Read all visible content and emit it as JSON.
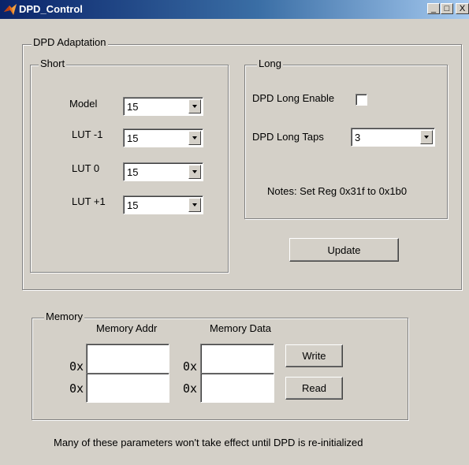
{
  "window": {
    "title": "DPD_Control",
    "minimize": "_",
    "maximize": "□",
    "close": "X"
  },
  "adaptation": {
    "legend": "DPD Adaptation",
    "short": {
      "legend": "Short",
      "rows": [
        {
          "label": "Model",
          "value": "15"
        },
        {
          "label": "LUT -1",
          "value": "15"
        },
        {
          "label": "LUT 0",
          "value": "15"
        },
        {
          "label": "LUT +1",
          "value": "15"
        }
      ]
    },
    "long": {
      "legend": "Long",
      "enable_label": "DPD Long Enable",
      "enable_checked": false,
      "taps_label": "DPD Long Taps",
      "taps_value": "3",
      "notes": "Notes: Set Reg 0x31f to 0x1b0"
    },
    "update_label": "Update"
  },
  "memory": {
    "legend": "Memory",
    "addr_header": "Memory Addr",
    "data_header": "Memory Data",
    "prefix": "0x",
    "addr_values": [
      "",
      ""
    ],
    "data_values": [
      "",
      ""
    ],
    "write_label": "Write",
    "read_label": "Read"
  },
  "footer_note": "Many of these parameters won't take effect until DPD is re-initialized"
}
